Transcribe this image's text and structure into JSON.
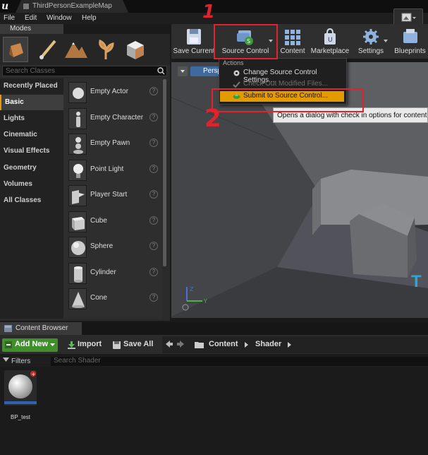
{
  "window": {
    "tab_title": "ThirdPersonExampleMap"
  },
  "menubar": {
    "items": [
      "File",
      "Edit",
      "Window",
      "Help"
    ]
  },
  "modes": {
    "tab_label": "Modes",
    "search_placeholder": "Search Classes",
    "categories": [
      "Recently Placed",
      "Basic",
      "Lights",
      "Cinematic",
      "Visual Effects",
      "Geometry",
      "Volumes",
      "All Classes"
    ],
    "active_category": "Basic",
    "items": [
      "Empty Actor",
      "Empty Character",
      "Empty Pawn",
      "Point Light",
      "Player Start",
      "Cube",
      "Sphere",
      "Cylinder",
      "Cone"
    ]
  },
  "toolbar": {
    "buttons": [
      "Save Current",
      "Source Control",
      "Content",
      "Marketplace",
      "Settings",
      "Blueprints"
    ]
  },
  "viewport": {
    "mode_label": "Persp"
  },
  "source_control_menu": {
    "header": "Actions",
    "items": [
      {
        "label": "Change Source Control Settings...",
        "state": "normal"
      },
      {
        "label": "Check Out Modified Files...",
        "state": "disabled"
      },
      {
        "label": "Submit to Source Control...",
        "state": "highlighted"
      }
    ],
    "tooltip": "Opens a dialog with check in options for content an"
  },
  "annotations": {
    "step1": "1",
    "step2": "2",
    "color": "#e2232d"
  },
  "content_browser": {
    "tab_label": "Content Browser",
    "add_new_label": "Add New",
    "import_label": "Import",
    "save_all_label": "Save All",
    "path": [
      "Content",
      "Shader"
    ],
    "filters_label": "Filters",
    "search_placeholder": "Search Shader",
    "assets": [
      {
        "name": "BP_test"
      }
    ]
  },
  "colors": {
    "accent": "#e39b00",
    "add_new": "#3f8f2a",
    "persp": "#3e6aa0"
  }
}
